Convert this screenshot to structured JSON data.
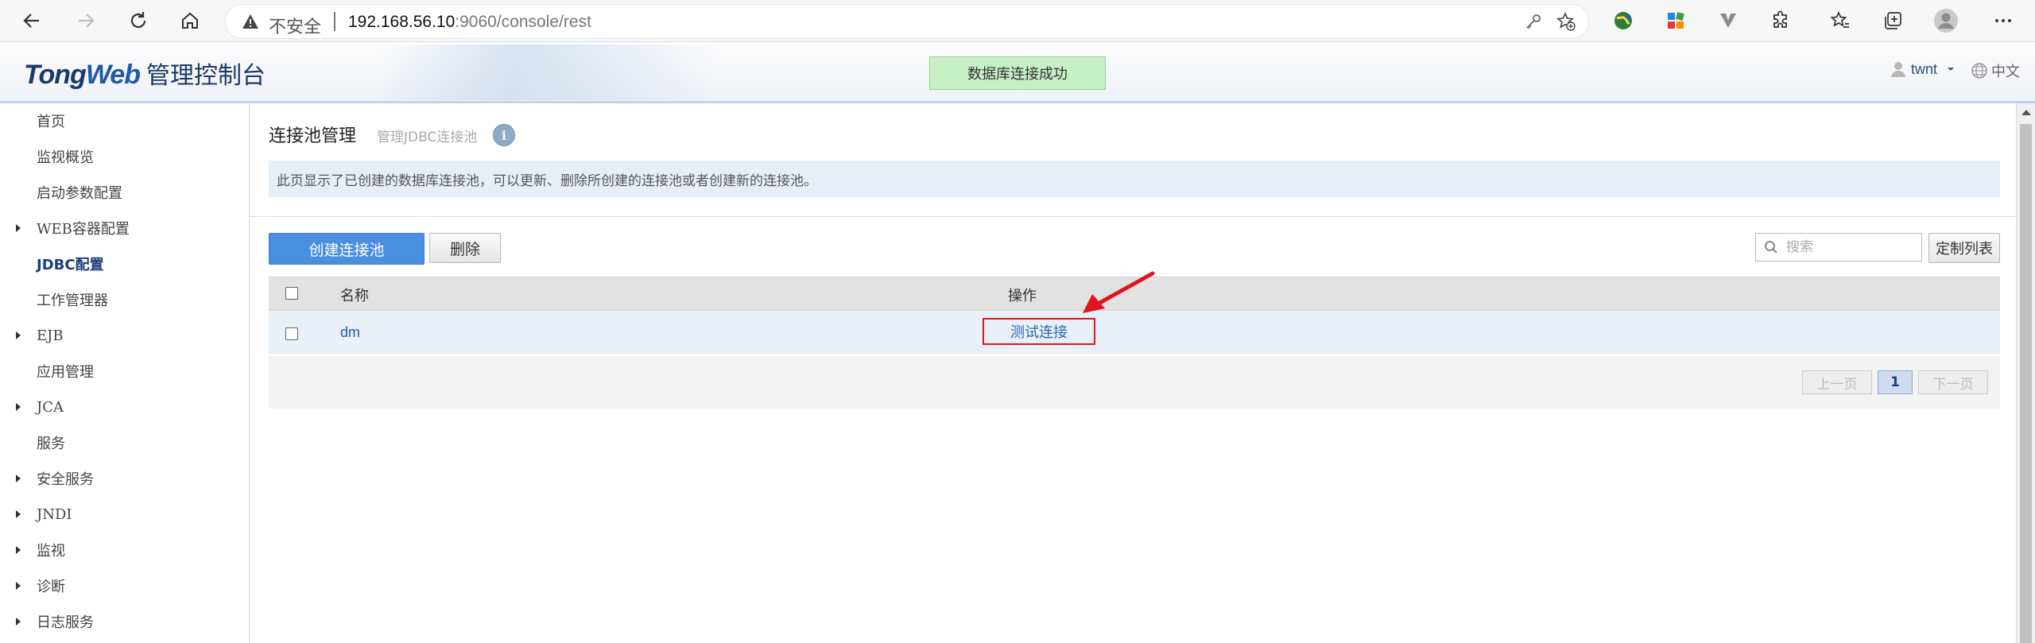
{
  "browser": {
    "insecure_label": "不安全",
    "url_host": "192.168.56.10",
    "url_rest": ":9060/console/rest"
  },
  "header": {
    "logo_brand_a": "Tong",
    "logo_brand_b": "Web",
    "logo_cn": "管理控制台",
    "success_message": "数据库连接成功",
    "user_name": "twnt",
    "language": "中文"
  },
  "sidebar": {
    "items": [
      {
        "label": "首页",
        "expandable": false
      },
      {
        "label": "监视概览",
        "expandable": false
      },
      {
        "label": "启动参数配置",
        "expandable": false
      },
      {
        "label": "WEB容器配置",
        "expandable": true
      },
      {
        "label": "JDBC配置",
        "expandable": false,
        "active": true
      },
      {
        "label": "工作管理器",
        "expandable": false
      },
      {
        "label": "EJB",
        "expandable": true
      },
      {
        "label": "应用管理",
        "expandable": false
      },
      {
        "label": "JCA",
        "expandable": true
      },
      {
        "label": "服务",
        "expandable": false
      },
      {
        "label": "安全服务",
        "expandable": true
      },
      {
        "label": "JNDI",
        "expandable": true
      },
      {
        "label": "监视",
        "expandable": true
      },
      {
        "label": "诊断",
        "expandable": true
      },
      {
        "label": "日志服务",
        "expandable": true
      }
    ]
  },
  "page": {
    "title": "连接池管理",
    "subtitle": "管理JDBC连接池",
    "info_glyph": "i",
    "description": "此页显示了已创建的数据库连接池，可以更新、删除所创建的连接池或者创建新的连接池。"
  },
  "toolbar": {
    "create_label": "创建连接池",
    "delete_label": "删除",
    "search_placeholder": "搜索",
    "customize_label": "定制列表"
  },
  "table": {
    "headers": {
      "name": "名称",
      "action": "操作"
    },
    "rows": [
      {
        "name": "dm",
        "action": "测试连接"
      }
    ]
  },
  "pagination": {
    "prev_label": "上一页",
    "current_page": "1",
    "next_label": "下一页"
  },
  "colors": {
    "accent": "#4a8ee0",
    "success_bg": "#c6efc6",
    "highlight": "#e0141e"
  }
}
